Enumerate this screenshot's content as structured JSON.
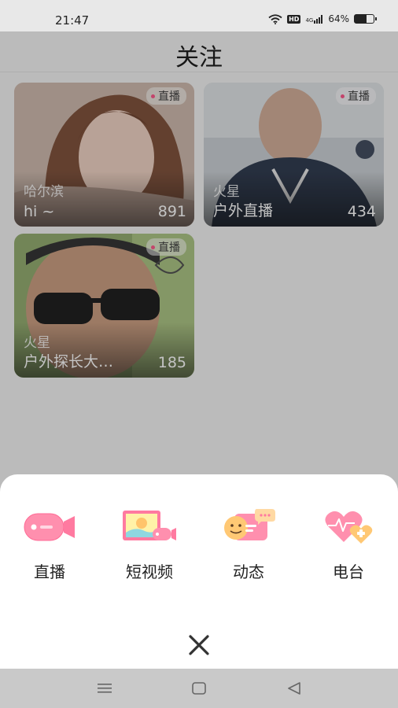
{
  "status_bar": {
    "time": "21:47",
    "hd_label": "HD",
    "network": "4G",
    "battery_text": "64%",
    "battery_level": 0.64,
    "icons": [
      "wifi-icon",
      "signal-icon",
      "battery-icon"
    ]
  },
  "header": {
    "title": "关注"
  },
  "streams": [
    {
      "badge": "直播",
      "city": "哈尔滨",
      "name": "hi ~",
      "viewers": "891"
    },
    {
      "badge": "直播",
      "city": "火星",
      "name": "户外直播",
      "viewers": "434"
    },
    {
      "badge": "直播",
      "city": "火星",
      "name": "户外探长大…",
      "viewers": "185"
    }
  ],
  "publish_sheet": {
    "options": [
      {
        "label": "直播",
        "icon": "live-camera-icon"
      },
      {
        "label": "短视频",
        "icon": "short-video-icon"
      },
      {
        "label": "动态",
        "icon": "moments-icon"
      },
      {
        "label": "电台",
        "icon": "radio-heart-icon"
      }
    ],
    "close_icon": "close-icon"
  },
  "nav_bar": {
    "icons": [
      "menu-icon",
      "home-icon",
      "back-icon"
    ]
  },
  "colors": {
    "accent": "#ff5f8a",
    "live_dot": "#ff4f86",
    "scrim": "#282828"
  }
}
